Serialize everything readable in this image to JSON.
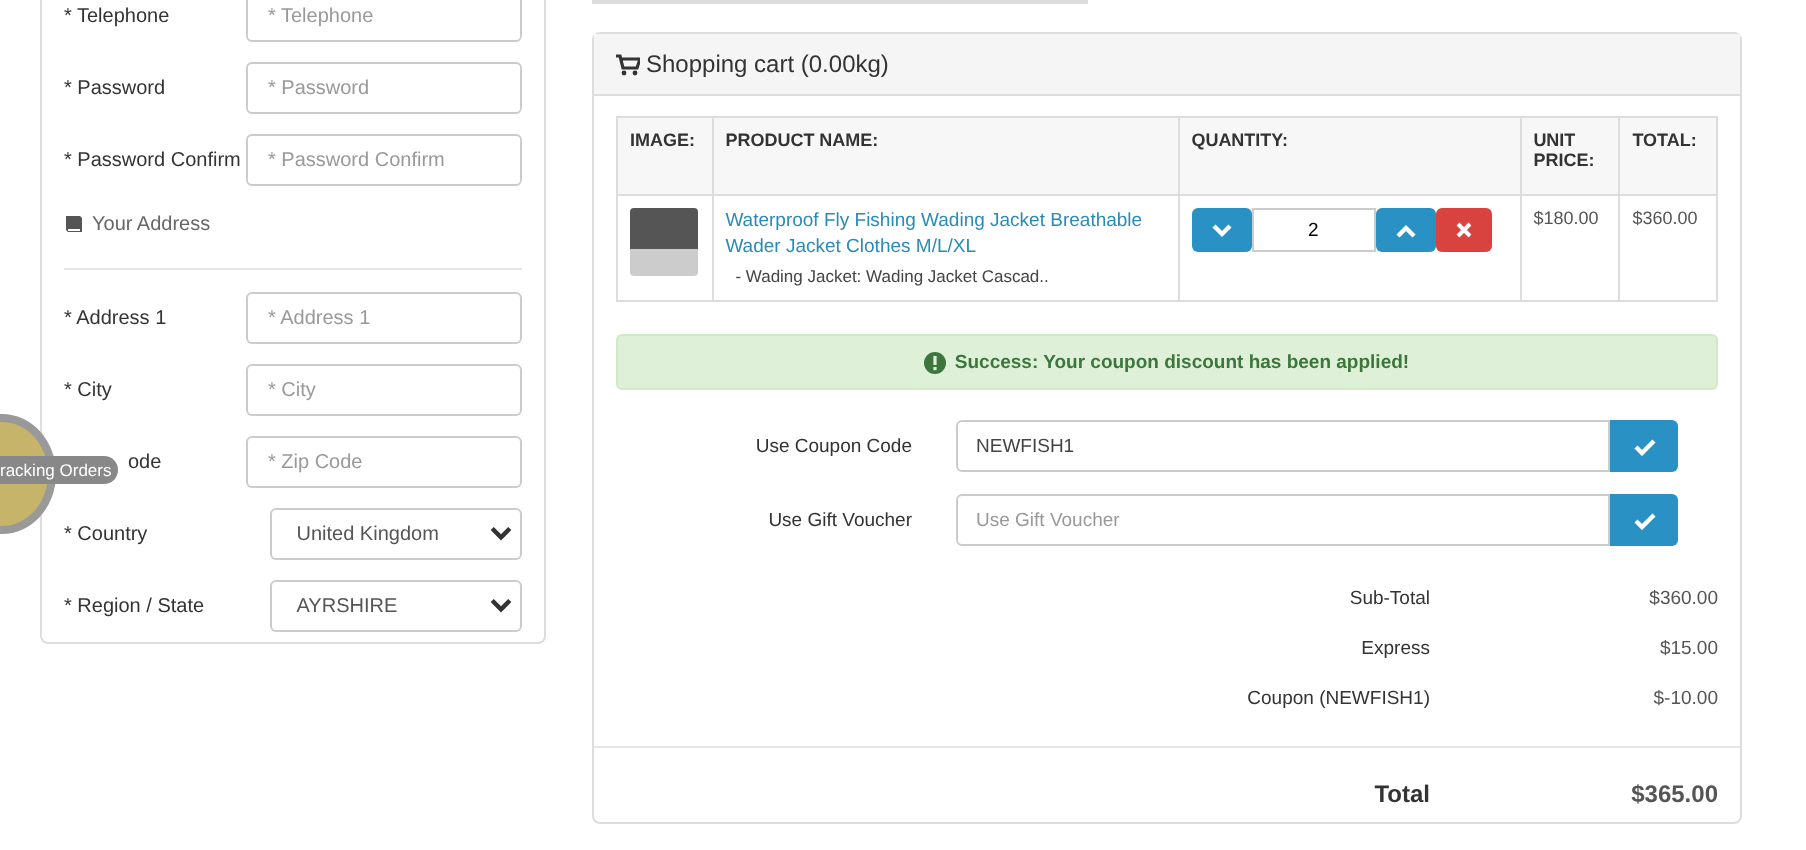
{
  "form": {
    "account_fields": [
      {
        "label": "* Telephone",
        "kind": "text",
        "placeholder": "* Telephone"
      },
      {
        "label": "* Password",
        "kind": "text",
        "placeholder": "* Password"
      },
      {
        "label": "* Password Confirm",
        "kind": "text",
        "placeholder": "* Password Confirm"
      }
    ],
    "address_heading": "Your Address",
    "address_fields": [
      {
        "label": "* Address 1",
        "kind": "text",
        "placeholder": "* Address 1"
      },
      {
        "label": "* City",
        "kind": "text",
        "placeholder": "* City"
      },
      {
        "label": "ode",
        "kind": "text",
        "placeholder": "* Zip Code",
        "covered": true
      },
      {
        "label": "* Country",
        "kind": "select",
        "value": "United Kingdom"
      },
      {
        "label": "* Region / State",
        "kind": "select",
        "value": "AYRSHIRE"
      }
    ]
  },
  "tracking_badge": {
    "label": "racking Orders"
  },
  "cart": {
    "title": "Shopping cart (0.00kg)",
    "columns": [
      "IMAGE:",
      "PRODUCT NAME:",
      "QUANTITY:",
      "UNIT PRICE:",
      "TOTAL:"
    ],
    "rows": [
      {
        "product": "Waterproof Fly Fishing Wading Jacket Breathable Wader Jacket Clothes M/L/XL",
        "option": "- Wading Jacket: Wading Jacket Cascad..",
        "quantity": "2",
        "unit_price": "$180.00",
        "total": "$360.00"
      }
    ],
    "alert": "Success: Your coupon discount has been applied!",
    "codes": [
      {
        "label": "Use Coupon Code",
        "value": "NEWFISH1"
      },
      {
        "label": "Use Gift Voucher",
        "placeholder": "Use Gift Voucher"
      }
    ],
    "totals": [
      {
        "label": "Sub-Total",
        "amount": "$360.00"
      },
      {
        "label": "Express",
        "amount": "$15.00"
      },
      {
        "label": "Coupon (NEWFISH1)",
        "amount": "$-10.00"
      }
    ],
    "grand_total": {
      "label": "Total",
      "amount": "$365.00"
    }
  }
}
